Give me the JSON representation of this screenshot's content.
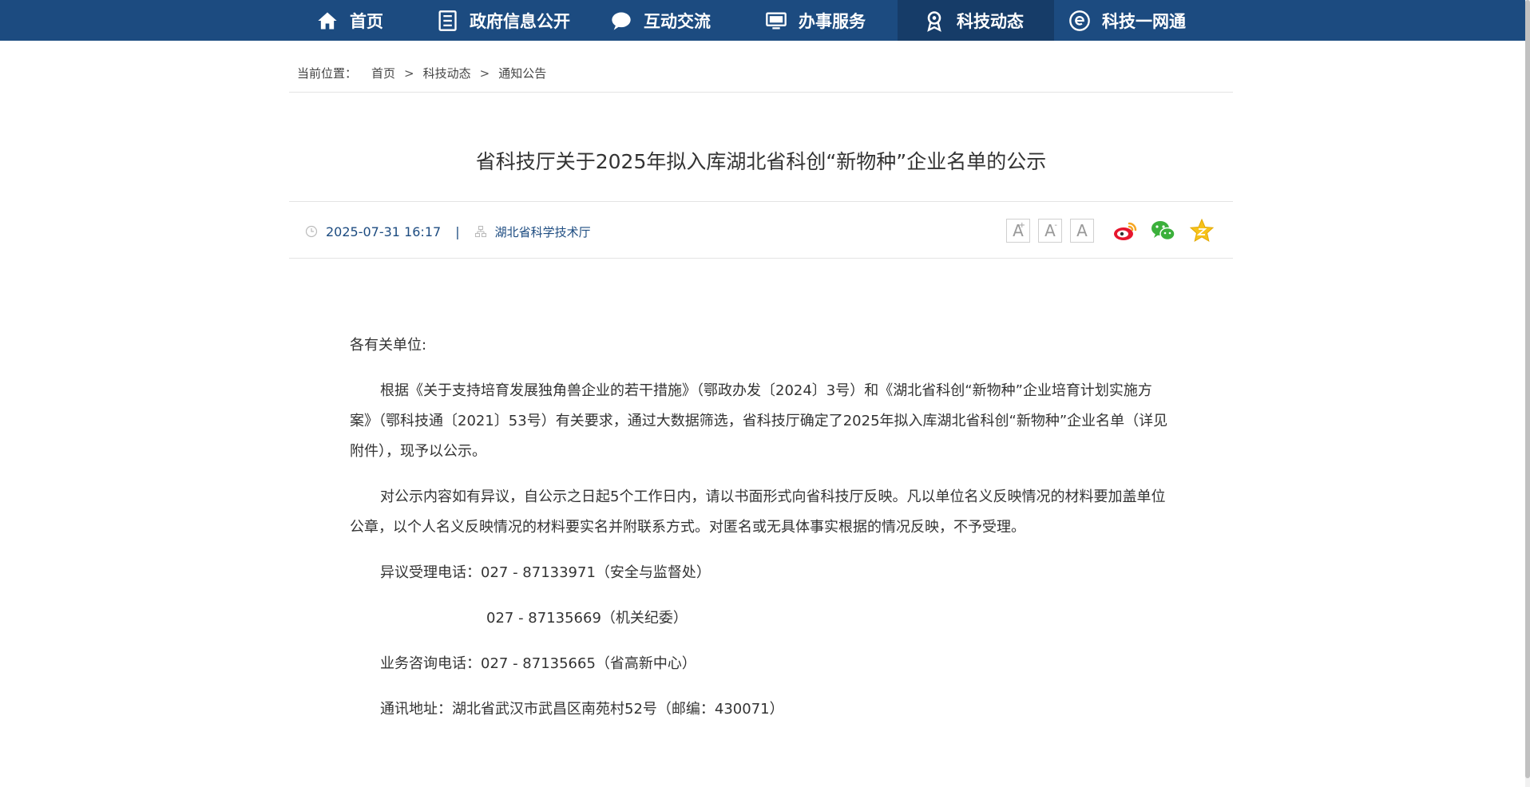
{
  "nav": {
    "items": [
      {
        "label": "首页",
        "icon": "home-icon"
      },
      {
        "label": "政府信息公开",
        "icon": "document-list-icon"
      },
      {
        "label": "互动交流",
        "icon": "chat-bubble-icon"
      },
      {
        "label": "办事服务",
        "icon": "monitor-icon"
      },
      {
        "label": "科技动态",
        "icon": "award-ribbon-icon",
        "active": true
      },
      {
        "label": "科技一网通",
        "icon": "e-circle-icon"
      }
    ]
  },
  "breadcrumb": {
    "label": "当前位置：",
    "items": [
      "首页",
      "科技动态",
      "通知公告"
    ],
    "separator": ">"
  },
  "article": {
    "title": "省科技厅关于2025年拟入库湖北省科创“新物种”企业名单的公示",
    "date": "2025-07-31 16:17",
    "divider": "|",
    "source": "湖北省科学技术厅",
    "font_controls": {
      "larger": "A",
      "smaller": "A",
      "reset": "A",
      "plus": "+",
      "minus": "-"
    },
    "share": [
      "weibo-icon",
      "wechat-icon",
      "favorite-star-icon"
    ],
    "salutation": "各有关单位:",
    "para1": "根据《关于支持培育发展独角兽企业的若干措施》（鄂政办发〔2024〕3号）和《湖北省科创“新物种”企业培育计划实施方案》（鄂科技通〔2021〕53号）有关要求，通过大数据筛选，省科技厅确定了2025年拟入库湖北省科创“新物种”企业名单（详见附件），现予以公示。",
    "para2": "对公示内容如有异议，自公示之日起5个工作日内，请以书面形式向省科技厅反映。凡以单位名义反映情况的材料要加盖单位公章，以个人名义反映情况的材料要实名并附联系方式。对匿名或无具体事实根据的情况反映，不予受理。",
    "phone1": "异议受理电话：027 - 87133971（安全与监督处）",
    "phone2": "027 - 87135669（机关纪委）",
    "phone3": "业务咨询电话：027 - 87135665（省高新中心）",
    "address": "通讯地址：湖北省武汉市武昌区南苑村52号（邮编：430071）"
  },
  "colors": {
    "nav_bg": "#1c4b80",
    "nav_active": "#163c68",
    "accent": "#1c4b80"
  }
}
